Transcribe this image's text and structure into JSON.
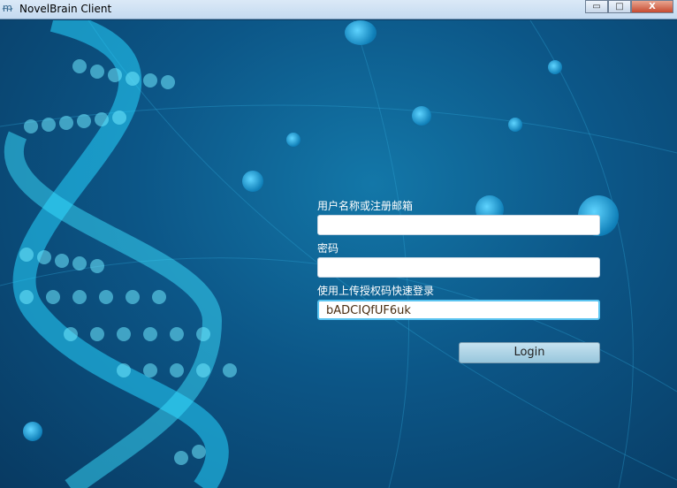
{
  "window": {
    "title": "NovelBrain Client",
    "minimize": "▭",
    "maximize": "□",
    "close": "X"
  },
  "form": {
    "username_label": "用户名称或注册邮箱",
    "username_value": "",
    "password_label": "密码",
    "password_value": "",
    "token_label": "使用上传授权码快速登录",
    "token_value": "bADCIQfUF6uk",
    "login_button": "Login"
  },
  "colors": {
    "background": "#0c5687",
    "accent": "#5bc4f0"
  }
}
